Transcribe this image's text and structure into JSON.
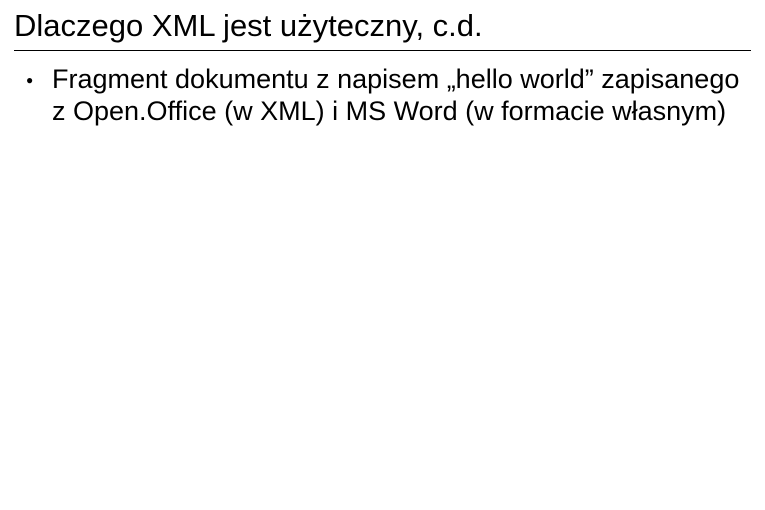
{
  "slide": {
    "title": "Dlaczego XML jest użyteczny, c.d.",
    "bullets": [
      "Fragment dokumentu z napisem „hello world” zapisanego z Open.Office (w XML) i MS Word (w formacie własnym)"
    ]
  }
}
